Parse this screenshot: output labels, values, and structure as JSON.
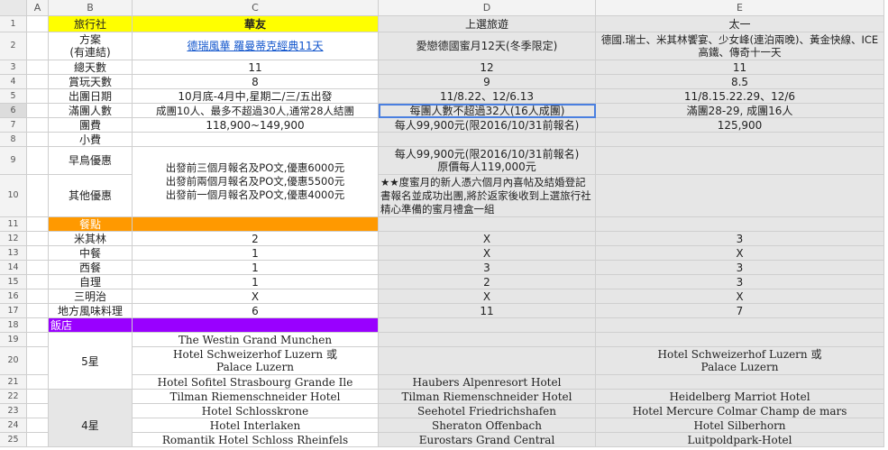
{
  "columns": [
    "A",
    "B",
    "C",
    "D",
    "E"
  ],
  "rows": [
    {
      "n": "1",
      "cells": [
        "",
        "旅行社",
        "華友",
        "上選旅遊",
        "太一"
      ]
    },
    {
      "n": "2",
      "cells": [
        "",
        "方案\n(有連結)",
        "德瑞風華 羅曼蒂克經典11天",
        "愛戀德國蜜月12天(冬季限定)",
        "德國.瑞士、米其林饗宴、少女峰(連泊兩晚)、黃金快線、ICE 高鐵、傳奇十一天"
      ]
    },
    {
      "n": "3",
      "cells": [
        "",
        "總天數",
        "11",
        "12",
        "11"
      ]
    },
    {
      "n": "4",
      "cells": [
        "",
        "賞玩天數",
        "8",
        "9",
        "8.5"
      ]
    },
    {
      "n": "5",
      "cells": [
        "",
        "出團日期",
        "10月底-4月中,星期二/三/五出發",
        "11/8.22、12/6.13",
        "11/8.15.22.29、12/6"
      ]
    },
    {
      "n": "6",
      "cells": [
        "",
        "滿團人數",
        "成團10人、最多不超過30人,通常28人結團",
        "每團人數不超過32人(16人成團)",
        "滿團28-29, 成團16人"
      ]
    },
    {
      "n": "7",
      "cells": [
        "",
        "團費",
        "118,900~149,900",
        "每人99,900元(限2016/10/31前報名)",
        "125,900"
      ]
    },
    {
      "n": "8",
      "cells": [
        "",
        "小費",
        "",
        "",
        ""
      ]
    },
    {
      "n": "9",
      "cells": [
        "",
        "早鳥優惠",
        "",
        "每人99,900元(限2016/10/31前報名)\n原價每人119,000元",
        ""
      ]
    },
    {
      "n": "10",
      "cells": [
        "",
        "其他優惠",
        "出發前三個月報名及PO文,優惠6000元\n出發前兩個月報名及PO文,優惠5500元\n出發前一個月報名及PO文,優惠4000元",
        "★★度蜜月的新人憑六個月內喜帖及結婚登記書報名並成功出團,將於返家後收到上選旅行社精心準備的蜜月禮盒一組",
        ""
      ]
    },
    {
      "n": "11",
      "cells": [
        "",
        "餐點",
        "",
        "",
        ""
      ]
    },
    {
      "n": "12",
      "cells": [
        "",
        "米其林",
        "2",
        "X",
        "3"
      ]
    },
    {
      "n": "13",
      "cells": [
        "",
        "中餐",
        "1",
        "X",
        "X"
      ]
    },
    {
      "n": "14",
      "cells": [
        "",
        "西餐",
        "1",
        "3",
        "3"
      ]
    },
    {
      "n": "15",
      "cells": [
        "",
        "自理",
        "1",
        "2",
        "3"
      ]
    },
    {
      "n": "16",
      "cells": [
        "",
        "三明治",
        "X",
        "X",
        "X"
      ]
    },
    {
      "n": "17",
      "cells": [
        "",
        "地方風味料理",
        "6",
        "11",
        "7"
      ]
    },
    {
      "n": "18",
      "cells": [
        "",
        "飯店",
        "",
        "",
        ""
      ]
    },
    {
      "n": "19",
      "cells": [
        "",
        "",
        "The Westin Grand Munchen",
        "",
        ""
      ]
    },
    {
      "n": "20",
      "cells": [
        "",
        "5星",
        "Hotel Schweizerhof Luzern 或\nPalace Luzern",
        "",
        "Hotel Schweizerhof Luzern 或\nPalace Luzern"
      ]
    },
    {
      "n": "21",
      "cells": [
        "",
        "",
        "Hotel Sofitel Strasbourg Grande Ile",
        "Haubers Alpenresort Hotel",
        ""
      ]
    },
    {
      "n": "22",
      "cells": [
        "",
        "",
        "Tilman Riemenschneider Hotel",
        "Tilman Riemenschneider Hotel",
        "Heidelberg Marriot Hotel"
      ]
    },
    {
      "n": "23",
      "cells": [
        "",
        "",
        "Hotel Schlosskrone",
        "Seehotel Friedrichshafen",
        "Hotel Mercure Colmar Champ de mars"
      ]
    },
    {
      "n": "24",
      "cells": [
        "",
        "4星",
        "Hotel Interlaken",
        "Sheraton Offenbach",
        "Hotel Silberhorn"
      ]
    },
    {
      "n": "25",
      "cells": [
        "",
        "",
        "Romantik Hotel Schloss Rheinfels",
        "Eurostars Grand Central",
        "Luitpoldpark-Hotel"
      ]
    }
  ]
}
